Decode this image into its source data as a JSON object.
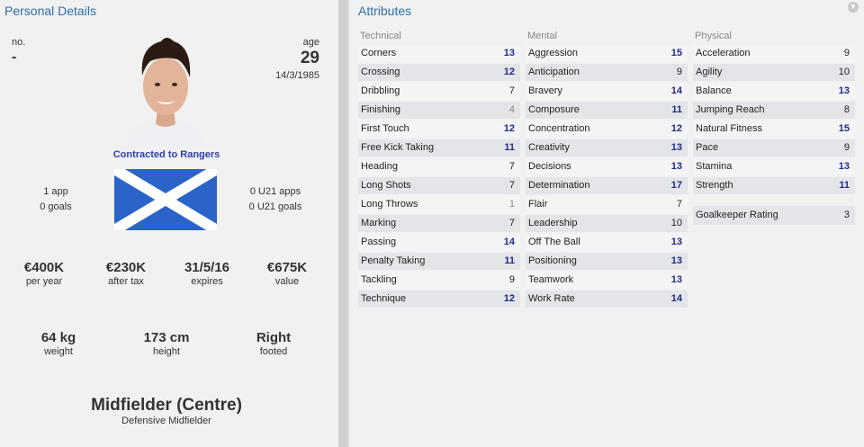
{
  "personal": {
    "title": "Personal Details",
    "no_label": "no.",
    "no_value": "-",
    "age_label": "age",
    "age_value": "29",
    "dob": "14/3/1985",
    "contract": "Contracted to Rangers",
    "apps": "1 app",
    "goals": "0 goals",
    "u21_apps": "0 U21 apps",
    "u21_goals": "0 U21 goals",
    "wage": "€400K",
    "wage_label": "per year",
    "after_tax": "€230K",
    "after_tax_label": "after tax",
    "expires": "31/5/16",
    "expires_label": "expires",
    "value": "€675K",
    "value_label": "value",
    "weight": "64 kg",
    "weight_label": "weight",
    "height": "173 cm",
    "height_label": "height",
    "foot": "Right",
    "foot_label": "footed",
    "position": "Midfielder (Centre)",
    "role": "Defensive Midfielder",
    "flag_colors": {
      "field": "#2b64c8",
      "cross": "#ffffff"
    }
  },
  "attributes": {
    "title": "Attributes",
    "technical": {
      "header": "Technical",
      "items": [
        {
          "name": "Corners",
          "value": 13
        },
        {
          "name": "Crossing",
          "value": 12
        },
        {
          "name": "Dribbling",
          "value": 7
        },
        {
          "name": "Finishing",
          "value": 4
        },
        {
          "name": "First Touch",
          "value": 12
        },
        {
          "name": "Free Kick Taking",
          "value": 11
        },
        {
          "name": "Heading",
          "value": 7
        },
        {
          "name": "Long Shots",
          "value": 7
        },
        {
          "name": "Long Throws",
          "value": 1
        },
        {
          "name": "Marking",
          "value": 7
        },
        {
          "name": "Passing",
          "value": 14
        },
        {
          "name": "Penalty Taking",
          "value": 11
        },
        {
          "name": "Tackling",
          "value": 9
        },
        {
          "name": "Technique",
          "value": 12
        }
      ]
    },
    "mental": {
      "header": "Mental",
      "items": [
        {
          "name": "Aggression",
          "value": 15
        },
        {
          "name": "Anticipation",
          "value": 9
        },
        {
          "name": "Bravery",
          "value": 14
        },
        {
          "name": "Composure",
          "value": 11
        },
        {
          "name": "Concentration",
          "value": 12
        },
        {
          "name": "Creativity",
          "value": 13
        },
        {
          "name": "Decisions",
          "value": 13
        },
        {
          "name": "Determination",
          "value": 17
        },
        {
          "name": "Flair",
          "value": 7
        },
        {
          "name": "Leadership",
          "value": 10
        },
        {
          "name": "Off The Ball",
          "value": 13
        },
        {
          "name": "Positioning",
          "value": 13
        },
        {
          "name": "Teamwork",
          "value": 13
        },
        {
          "name": "Work Rate",
          "value": 14
        }
      ]
    },
    "physical": {
      "header": "Physical",
      "items": [
        {
          "name": "Acceleration",
          "value": 9
        },
        {
          "name": "Agility",
          "value": 10
        },
        {
          "name": "Balance",
          "value": 13
        },
        {
          "name": "Jumping Reach",
          "value": 8
        },
        {
          "name": "Natural Fitness",
          "value": 15
        },
        {
          "name": "Pace",
          "value": 9
        },
        {
          "name": "Stamina",
          "value": 13
        },
        {
          "name": "Strength",
          "value": 11
        }
      ]
    },
    "goalkeeper_rating_label": "Goalkeeper Rating",
    "goalkeeper_rating_value": "3"
  }
}
